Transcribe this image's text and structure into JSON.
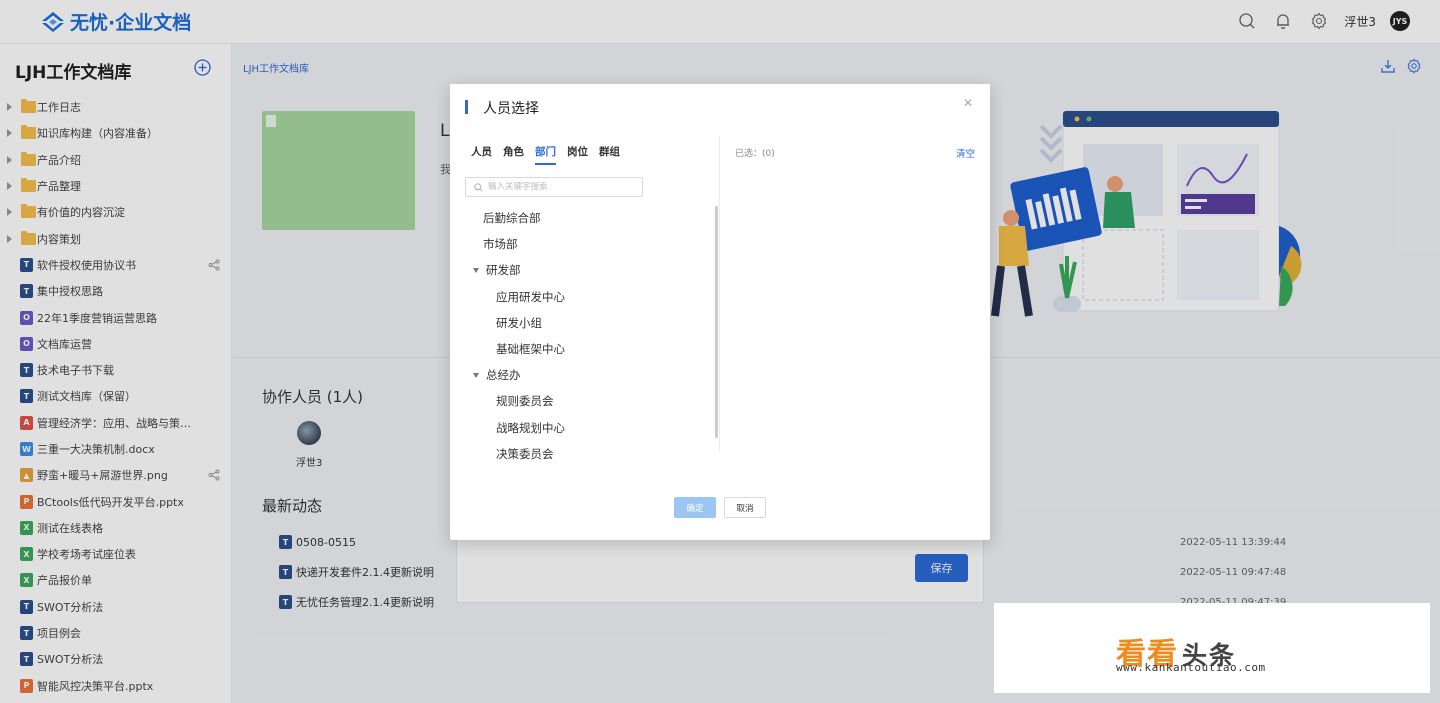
{
  "app": {
    "brand": "无忧·企业文档",
    "user_name": "浮世3",
    "avatar_text": "JYS",
    "accent": "#2d6ad8"
  },
  "sidebar": {
    "title": "LJH工作文档库",
    "items": [
      {
        "type": "folder",
        "label": "工作日志"
      },
      {
        "type": "folder",
        "label": "知识库构建（内容准备）"
      },
      {
        "type": "folder",
        "label": "产品介绍"
      },
      {
        "type": "folder",
        "label": "产品整理"
      },
      {
        "type": "folder",
        "label": "有价值的内容沉淀"
      },
      {
        "type": "folder",
        "label": "内容策划"
      },
      {
        "type": "file",
        "badge": "T",
        "color": "#2b4f8c",
        "label": "软件授权使用协议书",
        "shared": true
      },
      {
        "type": "file",
        "badge": "T",
        "color": "#2b4f8c",
        "label": "集中授权思路"
      },
      {
        "type": "file",
        "badge": "O",
        "color": "#6b5cc4",
        "label": "22年1季度营销运营思路"
      },
      {
        "type": "file",
        "badge": "O",
        "color": "#6b5cc4",
        "label": "文档库运营"
      },
      {
        "type": "file",
        "badge": "T",
        "color": "#2b4f8c",
        "label": "技术电子书下载"
      },
      {
        "type": "file",
        "badge": "T",
        "color": "#2b4f8c",
        "label": "测试文档库（保留）"
      },
      {
        "type": "file",
        "badge": "A",
        "color": "#e0534a",
        "label": "管理经济学：应用、战略与策略..."
      },
      {
        "type": "file",
        "badge": "W",
        "color": "#3d8fe0",
        "label": "三重一大决策机制.docx"
      },
      {
        "type": "file",
        "badge": "▲",
        "color": "#e8a23a",
        "label": "野蛮+暖马+屌游世界.png",
        "shared": true
      },
      {
        "type": "file",
        "badge": "P",
        "color": "#e8743a",
        "label": "BCtools低代码开发平台.pptx"
      },
      {
        "type": "file",
        "badge": "X",
        "color": "#3aab5c",
        "label": "测试在线表格"
      },
      {
        "type": "file",
        "badge": "X",
        "color": "#3aab5c",
        "label": "学校考场考试座位表"
      },
      {
        "type": "file",
        "badge": "X",
        "color": "#3aab5c",
        "label": "产品报价单"
      },
      {
        "type": "file",
        "badge": "T",
        "color": "#2b4f8c",
        "label": "SWOT分析法"
      },
      {
        "type": "file",
        "badge": "T",
        "color": "#2b4f8c",
        "label": "项目例会"
      },
      {
        "type": "file",
        "badge": "T",
        "color": "#2b4f8c",
        "label": "SWOT分析法"
      },
      {
        "type": "file",
        "badge": "P",
        "color": "#e8743a",
        "label": "智能风控决策平台.pptx"
      }
    ]
  },
  "main": {
    "breadcrumb": "LJH工作文档库",
    "hero_letter": "L",
    "hero_small": "我",
    "collaborators_title": "协作人员 (1人)",
    "collaborator_name": "浮世3",
    "news_title": "最新动态",
    "news": [
      {
        "label": "0508-0515",
        "date": "2022-05-11 13:39:44"
      },
      {
        "label": "快递开发套件2.1.4更新说明",
        "date": "2022-05-11 09:47:48"
      },
      {
        "label": "无忧任务管理2.1.4更新说明",
        "date": "2022-05-11 09:47:39"
      }
    ],
    "save_label": "保存"
  },
  "dialog": {
    "title": "人员选择",
    "tabs": [
      {
        "label": "人员",
        "active": false
      },
      {
        "label": "角色",
        "active": false
      },
      {
        "label": "部门",
        "active": true
      },
      {
        "label": "岗位",
        "active": false
      },
      {
        "label": "群组",
        "active": false
      }
    ],
    "search_placeholder": "输入关键字搜索",
    "departments": [
      {
        "label": "后勤综合部",
        "level": 0,
        "expandable": false
      },
      {
        "label": "市场部",
        "level": 0,
        "expandable": false
      },
      {
        "label": "研发部",
        "level": 0,
        "expandable": true
      },
      {
        "label": "应用研发中心",
        "level": 1,
        "expandable": false
      },
      {
        "label": "研发小组",
        "level": 1,
        "expandable": false
      },
      {
        "label": "基础框架中心",
        "level": 1,
        "expandable": false
      },
      {
        "label": "总经办",
        "level": 0,
        "expandable": true
      },
      {
        "label": "规则委员会",
        "level": 1,
        "expandable": false
      },
      {
        "label": "战略规划中心",
        "level": 1,
        "expandable": false
      },
      {
        "label": "决策委员会",
        "level": 1,
        "expandable": false
      }
    ],
    "selected_label": "已选：(0)",
    "clear_label": "清空",
    "ok_label": "确定",
    "cancel_label": "取消"
  },
  "watermark": {
    "cn_a": "看看",
    "cn_b": "头条",
    "url": "www.kankantoutiao.com"
  }
}
